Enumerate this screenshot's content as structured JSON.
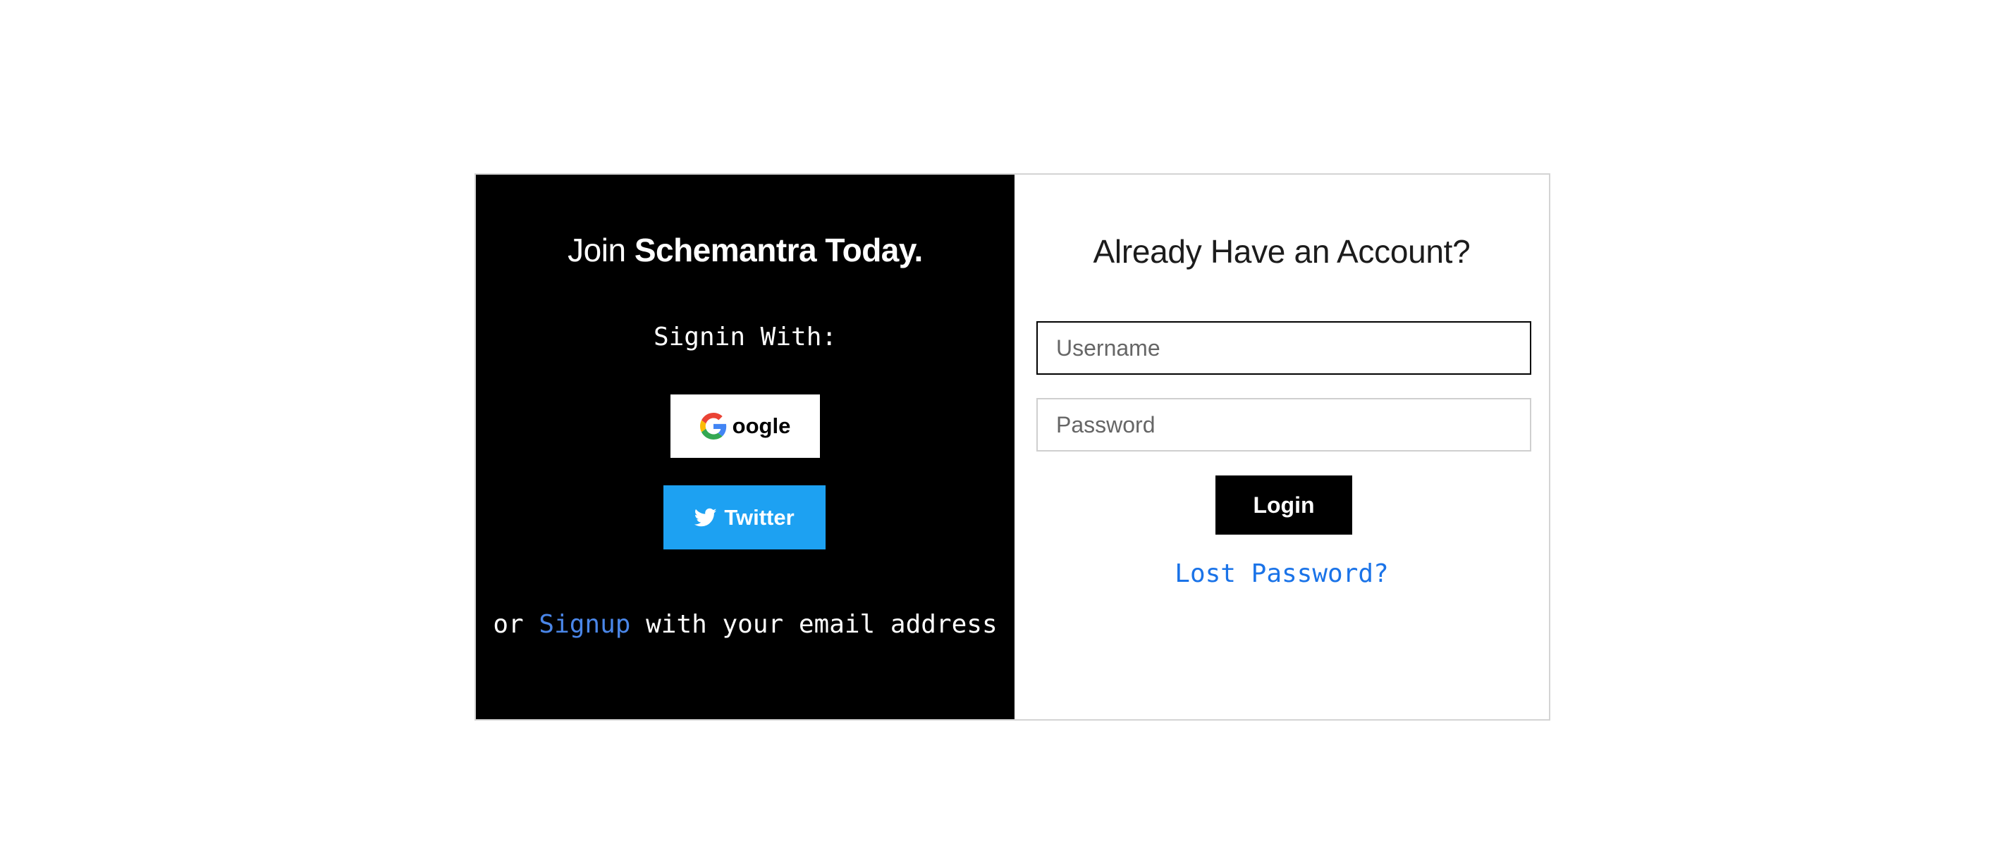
{
  "left_panel": {
    "title_prefix": "Join ",
    "title_brand": "Schemantra Today.",
    "signin_label": "Signin With:",
    "google_button_label": "oogle",
    "google_icon": "google-g-icon",
    "twitter_button_label": "Twitter",
    "twitter_icon": "twitter-bird-icon",
    "signup_prefix": "or ",
    "signup_link": "Signup",
    "signup_suffix": " with your email address"
  },
  "right_panel": {
    "title": "Already Have an Account?",
    "username_placeholder": "Username",
    "username_value": "",
    "password_placeholder": "Password",
    "password_value": "",
    "login_button_label": "Login",
    "lost_password_link": "Lost Password?"
  },
  "colors": {
    "left_panel_bg": "#000000",
    "twitter_blue": "#1da1f2",
    "signup_link": "#4a86e8",
    "lost_password_link": "#1a73e8",
    "login_button_bg": "#000000"
  }
}
